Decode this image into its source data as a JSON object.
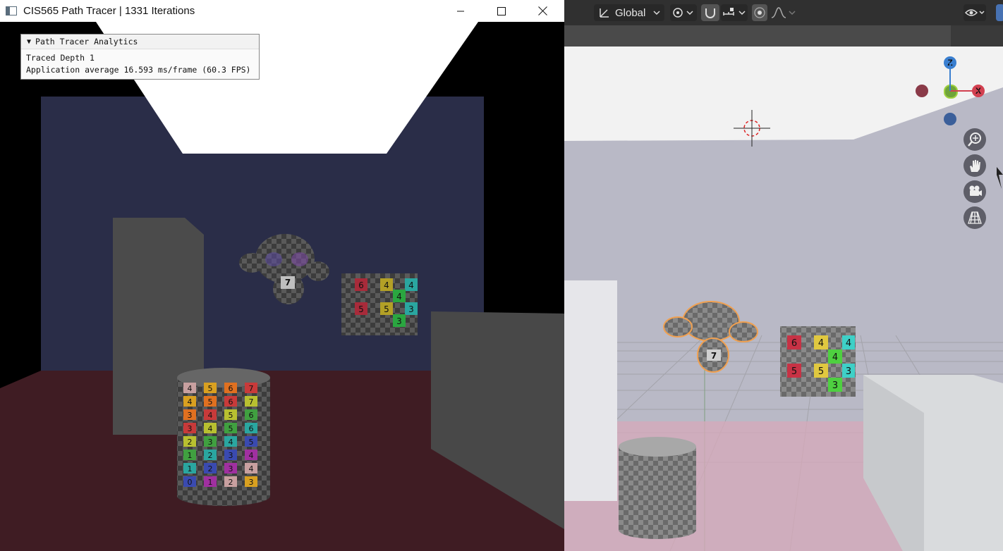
{
  "tracer": {
    "title": "CIS565 Path Tracer | 1331 Iterations",
    "analytics": {
      "header": "Path Tracer Analytics",
      "traced_depth": "Traced Depth 1",
      "app_average": "Application average 16.593 ms/frame (60.3 FPS)"
    },
    "cube_numbers": [
      "6",
      "5",
      "4",
      "4",
      "5",
      "3",
      "4",
      "3"
    ],
    "monkey_number": "7",
    "cylinder_rows": [
      [
        "4",
        "5",
        "6",
        "7"
      ],
      [
        "4",
        "5",
        "6",
        "7"
      ],
      [
        "3",
        "4",
        "5",
        "6"
      ],
      [
        "3",
        "4",
        "5",
        "6"
      ],
      [
        "2",
        "3",
        "4",
        "5"
      ],
      [
        "1",
        "2",
        "3",
        "4"
      ],
      [
        "1",
        "2",
        "3",
        "4"
      ],
      [
        "0",
        "1",
        "2",
        "3"
      ]
    ],
    "colors": {
      "sky": "#000000",
      "back_wall": "#2a2d48",
      "floor": "#3f1c23",
      "light": "#ffffff",
      "wall_gray": "#4b4b4b"
    }
  },
  "blender": {
    "transform_orientation": "Global",
    "gizmo": {
      "z_label": "Z",
      "x_label": "X"
    },
    "cube_numbers": [
      "6",
      "5",
      "4",
      "4",
      "5",
      "3",
      "4",
      "3"
    ],
    "monkey_number": "7",
    "colors": {
      "sky": "#b9b9c6",
      "floor": "#d7a9b9",
      "ceiling": "#f2f2f2",
      "grid": "#9b9b9f",
      "selection": "#f0a050"
    }
  }
}
